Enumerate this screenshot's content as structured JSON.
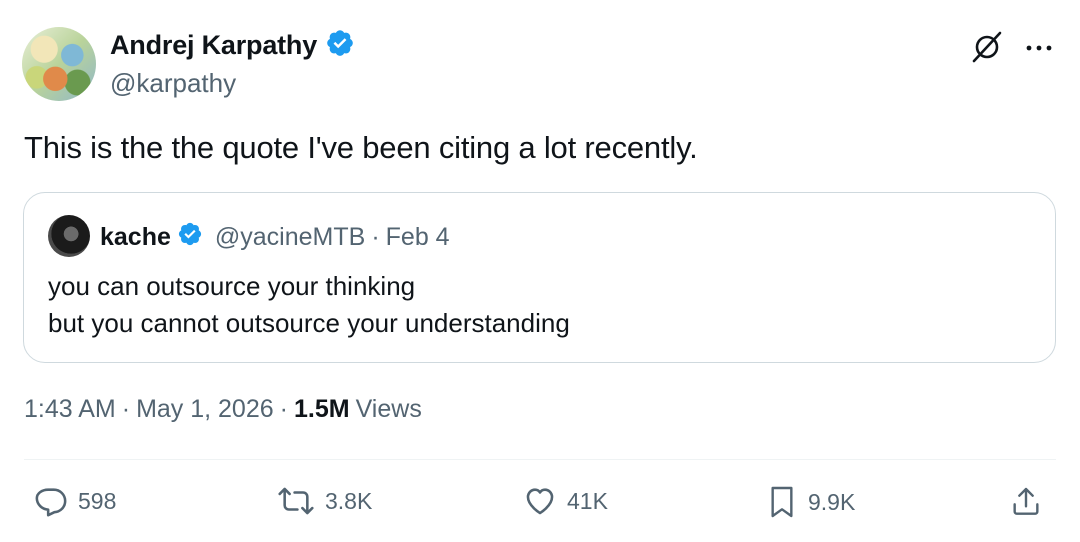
{
  "author": {
    "name": "Andrej Karpathy",
    "handle": "@karpathy",
    "verified_color": "#1d9bf0"
  },
  "tweet": {
    "text": "This is the the quote I've been citing a lot recently."
  },
  "quote": {
    "name": "kache",
    "handle": "@yacineMTB",
    "separator": "·",
    "date": "Feb 4",
    "line1": "you can outsource your thinking",
    "line2": "but you cannot outsource your understanding"
  },
  "meta": {
    "time": "1:43 AM",
    "sep1": "·",
    "date": "May 1, 2026",
    "sep2": "·",
    "views_count": "1.5M",
    "views_label": "Views"
  },
  "actions": {
    "replies": "598",
    "reposts": "3.8K",
    "likes": "41K",
    "bookmarks": "9.9K"
  },
  "icons": [
    "verified-badge-icon",
    "grok-icon",
    "more-icon",
    "reply-icon",
    "repost-icon",
    "like-icon",
    "bookmark-icon",
    "share-icon"
  ]
}
